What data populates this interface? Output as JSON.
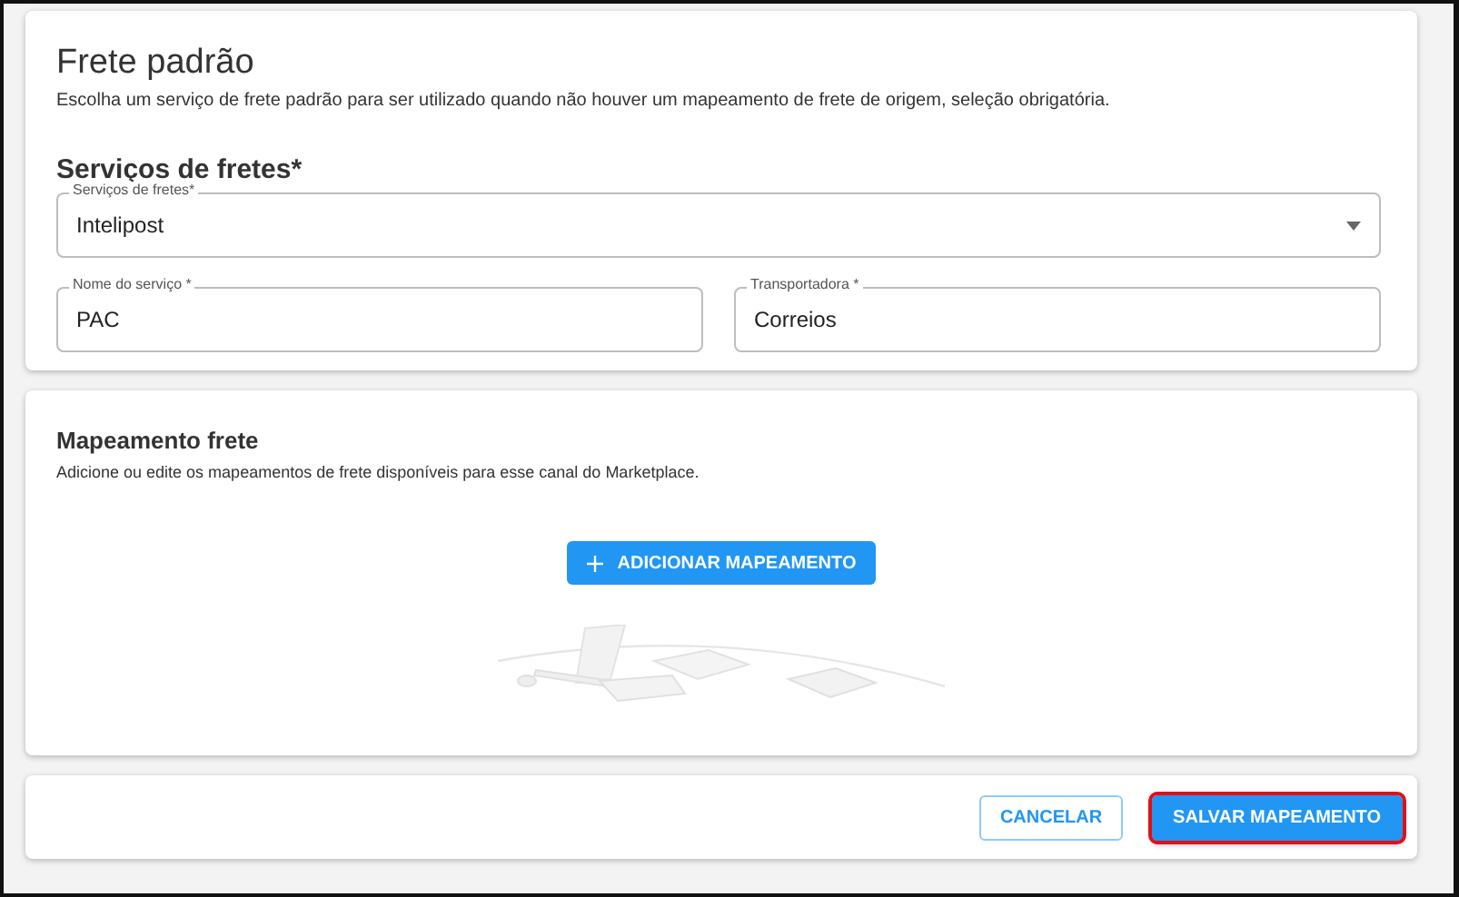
{
  "default_freight": {
    "title": "Frete padrão",
    "description": "Escolha um serviço de frete padrão para ser utilizado quando não houver um mapeamento de frete de origem, seleção obrigatória.",
    "section_title": "Serviços de fretes*",
    "service_select": {
      "label": "Serviços de fretes*",
      "value": "Intelipost"
    },
    "fields": [
      {
        "label": "Nome do serviço *",
        "value": "PAC"
      },
      {
        "label": "Transportadora *",
        "value": "Correios"
      }
    ]
  },
  "mapping": {
    "title": "Mapeamento frete",
    "description": "Adicione ou edite os mapeamentos de frete disponíveis para esse canal do Marketplace.",
    "add_button": "ADICIONAR MAPEAMENTO"
  },
  "footer": {
    "buttons": [
      {
        "label": "CANCELAR",
        "kind": "outlined",
        "highlighted": false
      },
      {
        "label": "SALVAR MAPEAMENTO",
        "kind": "primary",
        "highlighted": true
      }
    ]
  }
}
